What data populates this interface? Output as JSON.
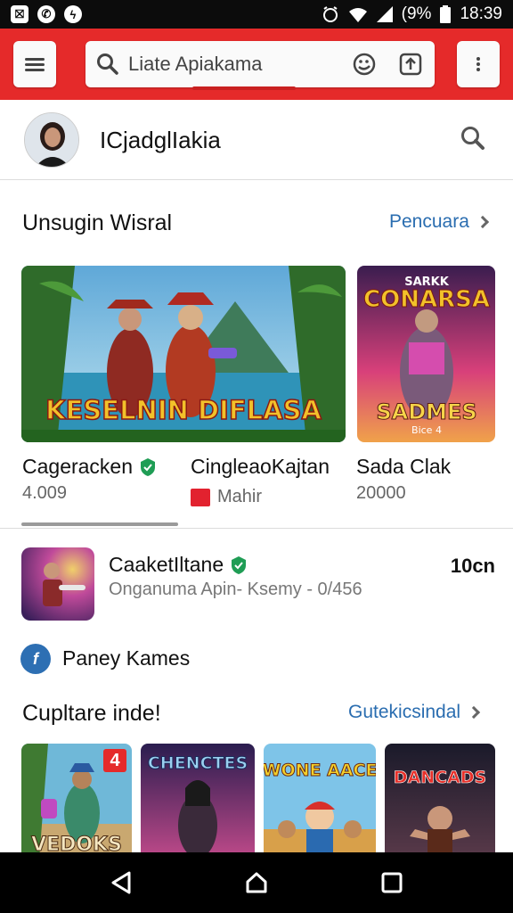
{
  "status_bar": {
    "left_icons": [
      "notification-icon",
      "whatsapp-icon",
      "messenger-icon"
    ],
    "battery": "(9%",
    "time": "18:39"
  },
  "toolbar": {
    "search_placeholder": "Liate Apiakama"
  },
  "profile": {
    "name": "ICjadglIakia"
  },
  "section1": {
    "title": "Unsugin Wisral",
    "link": "Pencuara"
  },
  "featured": [
    {
      "title": "Cageracken",
      "meta": "4.009",
      "art_text": "KESELNIN DIFLASA",
      "verified": true
    },
    {
      "title": "CingleaoKajtan",
      "meta": "Mahir",
      "verified": false
    },
    {
      "title": "Sada Clak",
      "meta": "20000",
      "art_top": "SARKK",
      "art_title": "CONARSA",
      "art_sub": "SADMES",
      "art_small": "Bice 4"
    }
  ],
  "list_item": {
    "title": "CaaketIltane",
    "subtitle": "Onganuma Apin- Ksemy - 0/456",
    "right": "10cn"
  },
  "publisher": {
    "logo": "f",
    "name": "Paney Kames"
  },
  "section2": {
    "title": "Cupltare inde!",
    "link": "Gutekicsindal"
  },
  "thumbs": [
    {
      "title": "VEDOKS",
      "badge": "4"
    },
    {
      "title": "CHENCTES"
    },
    {
      "title": "WONE AACE"
    },
    {
      "title": "DANCADS"
    }
  ],
  "colors": {
    "toolbar_red": "#e52a2a",
    "link_blue": "#2a6db0",
    "verified_green": "#1f9d55"
  }
}
